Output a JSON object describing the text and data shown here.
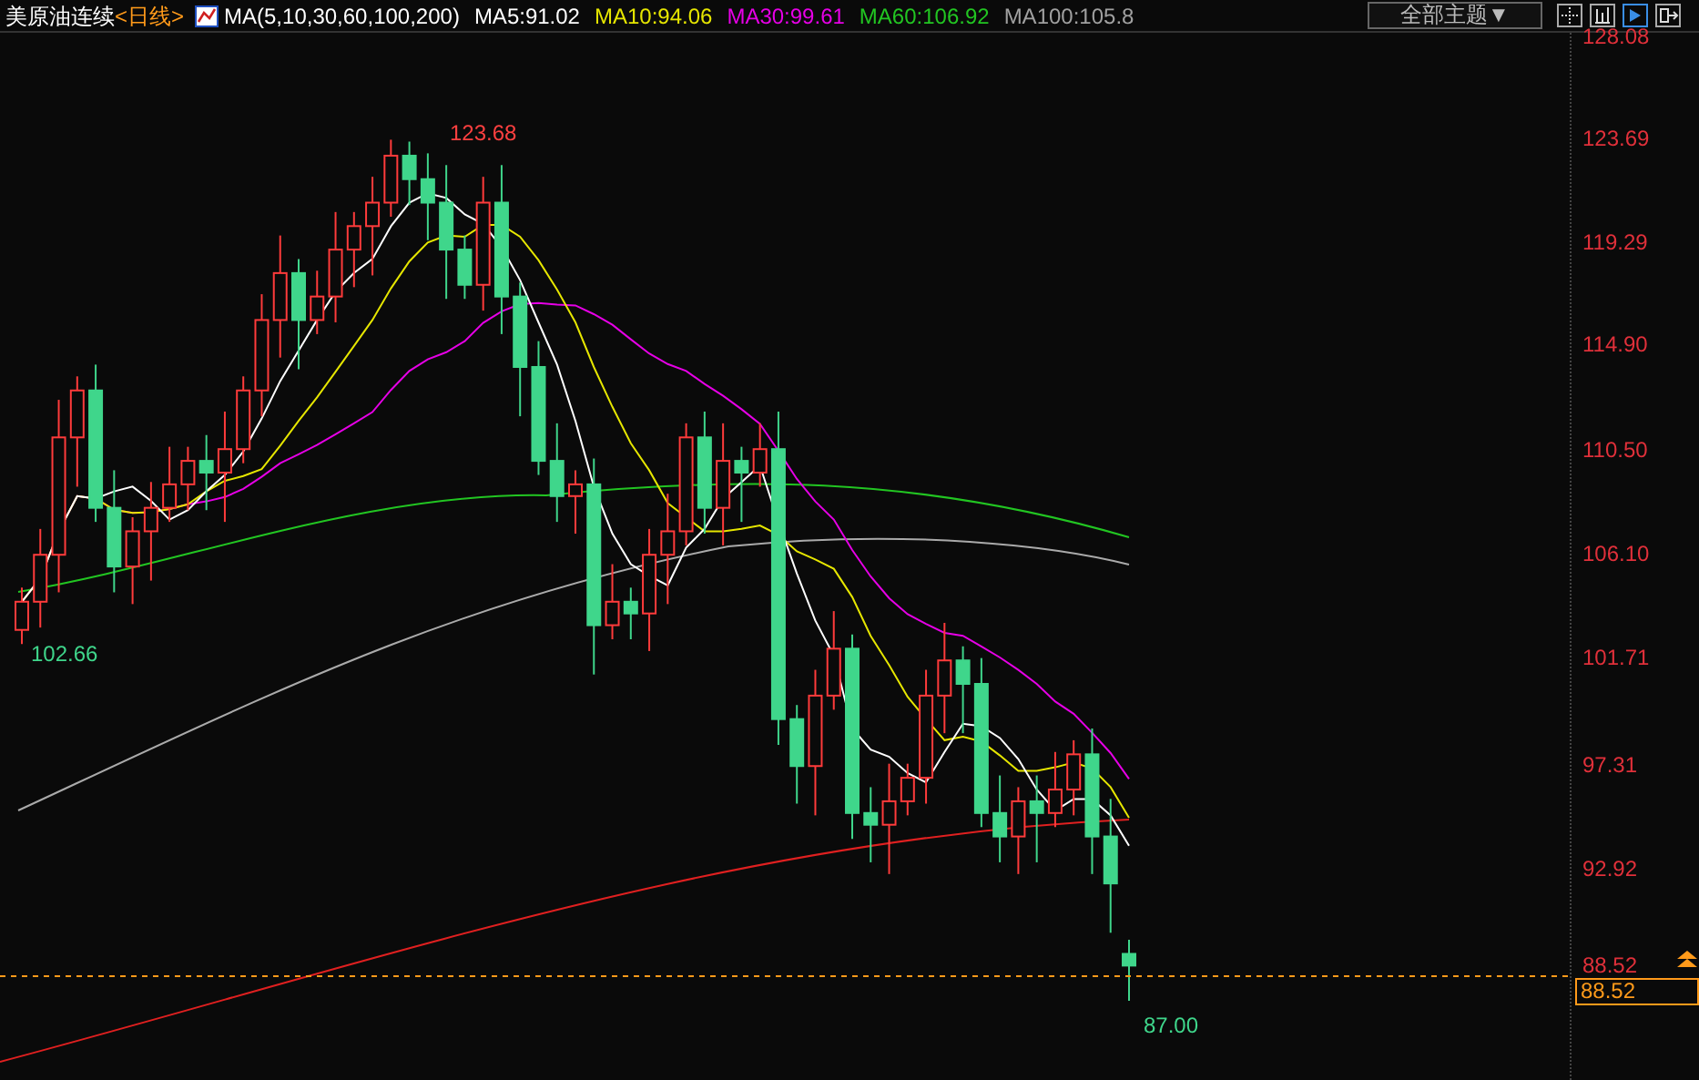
{
  "header": {
    "title": "美原油连续",
    "period": "<日线>",
    "indicator": "MA(5,10,30,60,100,200)",
    "legend": [
      {
        "label": "MA5:91.02",
        "color": "#ffffff"
      },
      {
        "label": "MA10:94.06",
        "color": "#e6e600"
      },
      {
        "label": "MA30:99.61",
        "color": "#e600e6"
      },
      {
        "label": "MA60:106.92",
        "color": "#22c522"
      },
      {
        "label": "MA100:105.8",
        "color": "#a0a0a0"
      }
    ],
    "theme_dropdown": "全部主题▼"
  },
  "y_axis": [
    "128.08",
    "123.69",
    "119.29",
    "114.90",
    "110.50",
    "106.10",
    "101.71",
    "97.31",
    "92.92",
    "88.52"
  ],
  "annotations": [
    {
      "kind": "high",
      "label": "123.68"
    },
    {
      "kind": "low",
      "label": "102.66"
    },
    {
      "kind": "low",
      "label": "87.00"
    }
  ],
  "last_price": "88.52"
}
